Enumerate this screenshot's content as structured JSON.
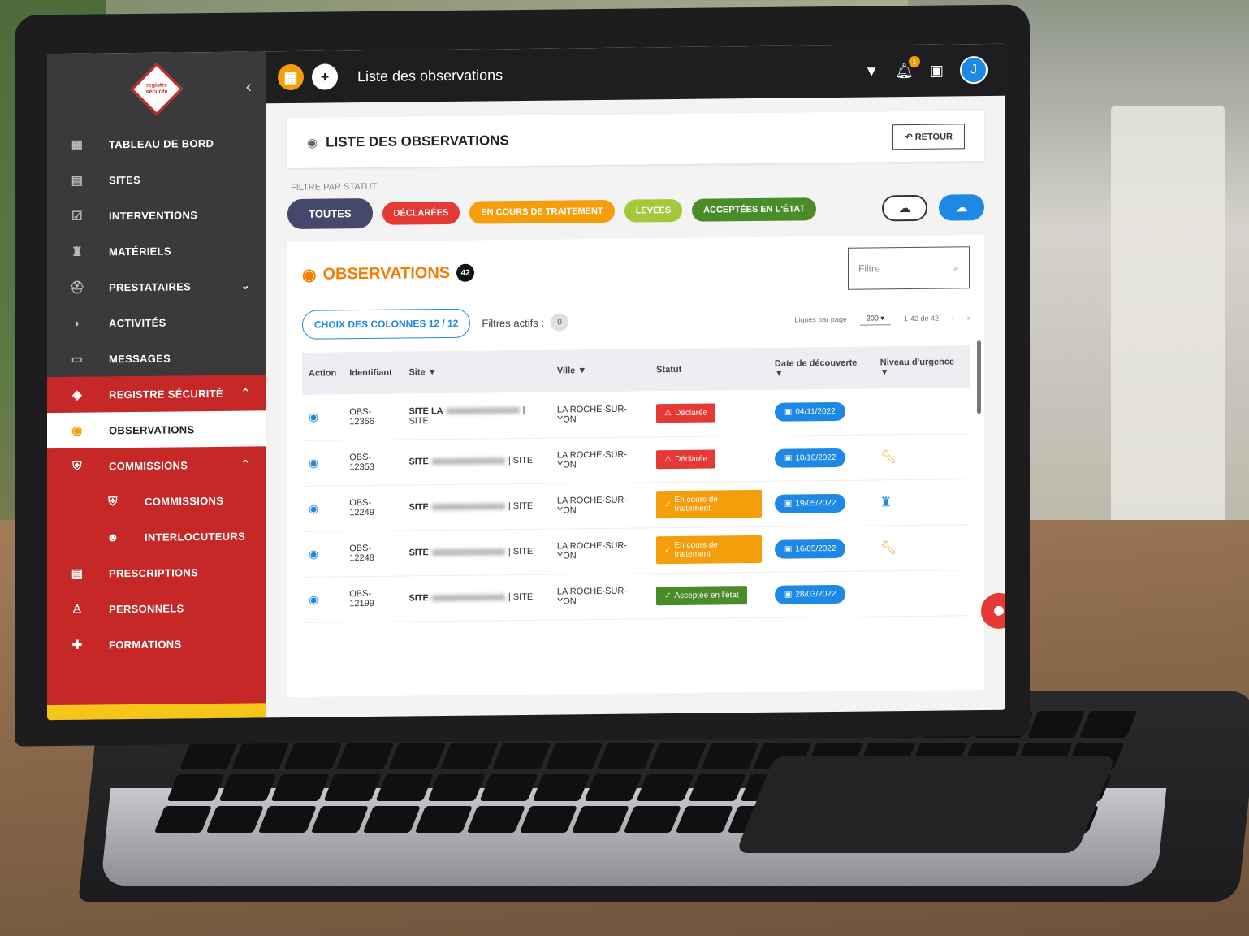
{
  "sidebar": {
    "logo_text": "registre sécurité",
    "collapse_icon": "chevron-left-icon",
    "items": [
      {
        "label": "TABLEAU DE BORD",
        "icon": "dashboard-icon"
      },
      {
        "label": "SITES",
        "icon": "building-icon"
      },
      {
        "label": "INTERVENTIONS",
        "icon": "clipboard-check-icon"
      },
      {
        "label": "MATÉRIELS",
        "icon": "extinguisher-icon"
      },
      {
        "label": "PRESTATAIRES",
        "icon": "helmet-icon"
      },
      {
        "label": "ACTIVITÉS",
        "icon": "activity-icon"
      },
      {
        "label": "MESSAGES",
        "icon": "message-icon"
      }
    ],
    "registre": {
      "label": "REGISTRE SÉCURITÉ",
      "icon": "registre-logo-icon"
    },
    "observations": {
      "label": "OBSERVATIONS",
      "icon": "eye-icon"
    },
    "commissions": {
      "label": "COMMISSIONS",
      "icon": "shield-icon"
    },
    "sub_commissions": {
      "label": "COMMISSIONS",
      "icon": "shield-icon"
    },
    "interlocuteurs": {
      "label": "INTERLOCUTEURS",
      "icon": "user-icon"
    },
    "prescriptions": {
      "label": "PRESCRIPTIONS",
      "icon": "document-icon"
    },
    "personnels": {
      "label": "PERSONNELS",
      "icon": "person-icon"
    },
    "formations": {
      "label": "FORMATIONS",
      "icon": "puzzle-icon"
    }
  },
  "topbar": {
    "title": "Liste des observations",
    "bell_badge": "1",
    "avatar_initial": "J"
  },
  "header": {
    "title": "LISTE DES OBSERVATIONS",
    "retour": "RETOUR"
  },
  "filters": {
    "label": "FILTRE PAR STATUT",
    "chips": {
      "toutes": "TOUTES",
      "declarees": "DÉCLARÉES",
      "encours": "EN COURS DE TRAITEMENT",
      "levees": "LEVÉES",
      "acceptees": "ACCEPTÉES EN L'ÉTAT"
    }
  },
  "panel": {
    "title": "OBSERVATIONS",
    "count": "42",
    "filter_placeholder": "Filtre",
    "columns_button": "CHOIX DES COLONNES 12 / 12",
    "active_filters_label": "Filtres actifs :",
    "active_filters_count": "0",
    "rows_per_page_label": "Lignes par page",
    "rows_per_page": "200",
    "range": "1-42 de 42"
  },
  "table": {
    "headers": {
      "action": "Action",
      "identifiant": "Identifiant",
      "site": "Site",
      "ville": "Ville",
      "statut": "Statut",
      "date": "Date de découverte",
      "urgence": "Niveau d'urgence"
    },
    "rows": [
      {
        "id": "OBS-12366",
        "site": "SITE LA",
        "site_suffix": "| SITE",
        "ville": "LA ROCHE-SUR-YON",
        "statut": "Déclarée",
        "statut_type": "declaree",
        "date": "04/11/2022",
        "urgence": ""
      },
      {
        "id": "OBS-12353",
        "site": "SITE",
        "site_suffix": "| SITE",
        "ville": "LA ROCHE-SUR-YON",
        "statut": "Déclarée",
        "statut_type": "declaree",
        "date": "10/10/2022",
        "urgence": "wrench"
      },
      {
        "id": "OBS-12249",
        "site": "SITE",
        "site_suffix": "| SITE",
        "ville": "LA ROCHE-SUR-YON",
        "statut": "En cours de traitement",
        "statut_type": "encours",
        "date": "19/05/2022",
        "urgence": "fire-extinguisher"
      },
      {
        "id": "OBS-12248",
        "site": "SITE",
        "site_suffix": "| SITE",
        "ville": "LA ROCHE-SUR-YON",
        "statut": "En cours de traitement",
        "statut_type": "encours",
        "date": "16/05/2022",
        "urgence": "wrench"
      },
      {
        "id": "OBS-12199",
        "site": "SITE",
        "site_suffix": "| SITE",
        "ville": "LA ROCHE-SUR-YON",
        "statut": "Acceptée en l'état",
        "statut_type": "acceptee",
        "date": "28/03/2022",
        "urgence": ""
      }
    ]
  },
  "colors": {
    "sidebar": "#3a3a3c",
    "red": "#c62828",
    "orange": "#f59e0b",
    "blue": "#1e88e5",
    "green": "#4a8c2a",
    "lime": "#a3c93a"
  }
}
